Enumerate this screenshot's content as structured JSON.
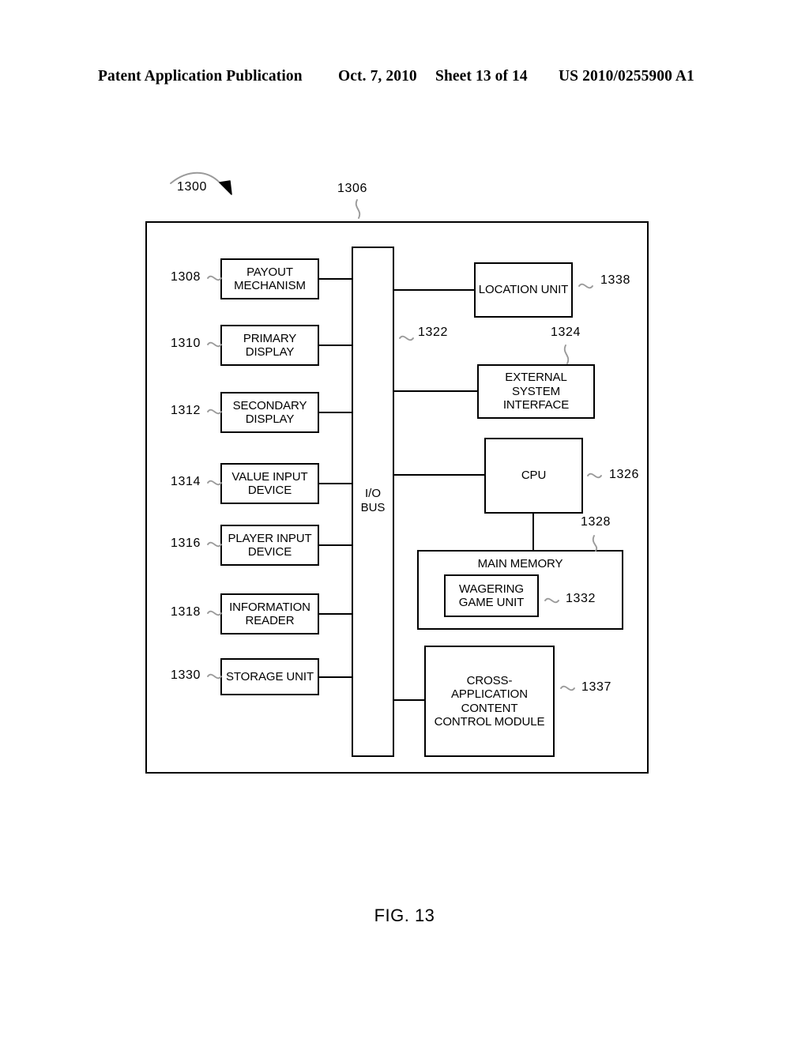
{
  "header": {
    "publication": "Patent Application Publication",
    "date": "Oct. 7, 2010",
    "sheet": "Sheet 13 of 14",
    "patent_number": "US 2010/0255900 A1"
  },
  "figure": {
    "caption": "FIG. 13",
    "system_ref": "1300",
    "frame_ref": "1306",
    "bus_label": "I/O\nBUS",
    "bus_ref": "1322"
  },
  "nodes": {
    "payout_mechanism": {
      "label": "PAYOUT\nMECHANISM",
      "ref": "1308"
    },
    "primary_display": {
      "label": "PRIMARY\nDISPLAY",
      "ref": "1310"
    },
    "secondary_display": {
      "label": "SECONDARY\nDISPLAY",
      "ref": "1312"
    },
    "value_input_device": {
      "label": "VALUE INPUT\nDEVICE",
      "ref": "1314"
    },
    "player_input_device": {
      "label": "PLAYER INPUT\nDEVICE",
      "ref": "1316"
    },
    "information_reader": {
      "label": "INFORMATION\nREADER",
      "ref": "1318"
    },
    "storage_unit": {
      "label": "STORAGE UNIT",
      "ref": "1330"
    },
    "location_unit": {
      "label": "LOCATION UNIT",
      "ref": "1338"
    },
    "external_system_interface": {
      "label": "EXTERNAL\nSYSTEM\nINTERFACE",
      "ref": "1324"
    },
    "cpu": {
      "label": "CPU",
      "ref": "1326"
    },
    "main_memory": {
      "label": "MAIN MEMORY",
      "ref": "1328"
    },
    "wagering_game_unit": {
      "label": "WAGERING\nGAME UNIT",
      "ref": "1332"
    },
    "cross_application_content_control_module": {
      "label": "CROSS-\nAPPLICATION\nCONTENT\nCONTROL MODULE",
      "ref": "1337"
    }
  },
  "colors": {
    "ink": "#000000",
    "paper": "#ffffff"
  }
}
